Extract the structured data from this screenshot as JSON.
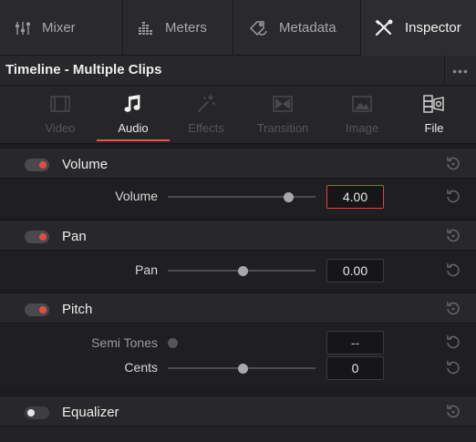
{
  "topbar": {
    "tabs": [
      {
        "label": "Mixer",
        "icon": "mixer-icon"
      },
      {
        "label": "Meters",
        "icon": "meters-icon"
      },
      {
        "label": "Metadata",
        "icon": "metadata-icon"
      },
      {
        "label": "Inspector",
        "icon": "inspector-icon",
        "active": true
      }
    ]
  },
  "header": {
    "title": "Timeline - Multiple Clips",
    "more": "•••"
  },
  "categories": [
    {
      "label": "Video",
      "icon": "video-icon",
      "enabled": false
    },
    {
      "label": "Audio",
      "icon": "music-note-icon",
      "enabled": true,
      "selected": true
    },
    {
      "label": "Effects",
      "icon": "effects-wand-icon",
      "enabled": false
    },
    {
      "label": "Transition",
      "icon": "transition-icon",
      "enabled": false
    },
    {
      "label": "Image",
      "icon": "image-icon",
      "enabled": false
    },
    {
      "label": "File",
      "icon": "file-icon",
      "enabled": true
    }
  ],
  "sections": {
    "volume": {
      "title": "Volume",
      "enabled": true,
      "params": [
        {
          "label": "Volume",
          "value": "4.00",
          "slider_fraction": 0.82,
          "active": true
        }
      ]
    },
    "pan": {
      "title": "Pan",
      "enabled": true,
      "params": [
        {
          "label": "Pan",
          "value": "0.00",
          "slider_fraction": 0.5
        }
      ]
    },
    "pitch": {
      "title": "Pitch",
      "enabled": true,
      "params": [
        {
          "label": "Semi Tones",
          "value": "--",
          "disabled": true
        },
        {
          "label": "Cents",
          "value": "0",
          "slider_fraction": 0.5
        }
      ]
    },
    "equalizer": {
      "title": "Equalizer",
      "enabled": false
    }
  },
  "colors": {
    "accent": "#e74c3c",
    "panel_bg": "#1c1c1e",
    "header_bg": "#28282b"
  }
}
